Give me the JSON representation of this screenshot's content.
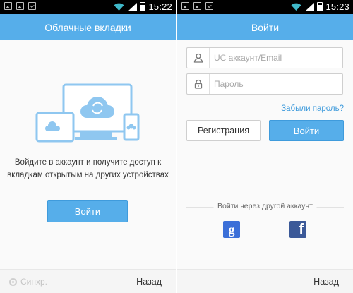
{
  "status_bar": {
    "left_time": "15:22",
    "right_time": "15:23",
    "icons": [
      "image-icon",
      "image-icon",
      "bag-icon",
      "wifi-icon",
      "signal-icon",
      "battery-icon"
    ]
  },
  "left": {
    "title": "Облачные вкладки",
    "message_line1": "Войдите в аккаунт и получите доступ к",
    "message_line2": "вкладкам открытым на других устройствах",
    "login_label": "Войти",
    "sync_label": "Синхр.",
    "back_label": "Назад"
  },
  "right": {
    "title": "Войти",
    "account_placeholder": "UC аккаунт/Email",
    "password_placeholder": "Пароль",
    "forgot_label": "Забыли пароль?",
    "register_label": "Регистрация",
    "login_label": "Войти",
    "other_account_label": "Войти через другой аккаунт",
    "google_glyph": "g",
    "facebook_glyph": "f",
    "back_label": "Назад"
  },
  "colors": {
    "accent": "#56aeea",
    "illustration": "#8fc7f0",
    "google": "#3b6fd8",
    "facebook": "#3b5998"
  }
}
